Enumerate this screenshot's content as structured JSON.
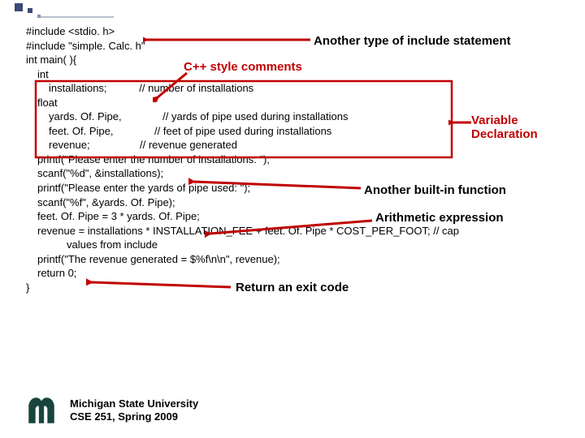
{
  "code": {
    "l1": "#include <stdio. h>",
    "l2": "#include \"simple. Calc. h\"",
    "l3": "int main( ){",
    "l4": "int",
    "l5": "installations;           // number of installations",
    "l6": "float",
    "l7": "yards. Of. Pipe,              // yards of pipe used during installations",
    "l8": "feet. Of. Pipe,              // feet of pipe used during installations",
    "l9": "revenue;                 // revenue generated",
    "l10": "printf(\"Please enter the number of installations: \");",
    "l11": "scanf(\"%d\", &installations);",
    "l12": "printf(\"Please enter the yards of pipe used: \");",
    "l13": "scanf(\"%f\", &yards. Of. Pipe);",
    "l14": "feet. Of. Pipe = 3 * yards. Of. Pipe;",
    "l15": "revenue = installations * INSTALLATION_FEE + feet. Of. Pipe * COST_PER_FOOT; // cap",
    "l15b": "values from include",
    "l16": "printf(\"The revenue generated = $%f\\n\\n\", revenue);",
    "l17": "return 0;",
    "l18": "}"
  },
  "ann": {
    "another_include": "Another type of include statement",
    "cpp_comments": "C++ style comments",
    "variable_decl": "Variable\nDeclaration",
    "builtin_fn": "Another built-in function",
    "arith_expr": "Arithmetic expression",
    "return_exit": "Return an exit code"
  },
  "footer": {
    "l1": "Michigan State University",
    "l2": "CSE 251, Spring 2009"
  },
  "colors": {
    "red": "#c00000",
    "msu_green": "#18453B"
  }
}
